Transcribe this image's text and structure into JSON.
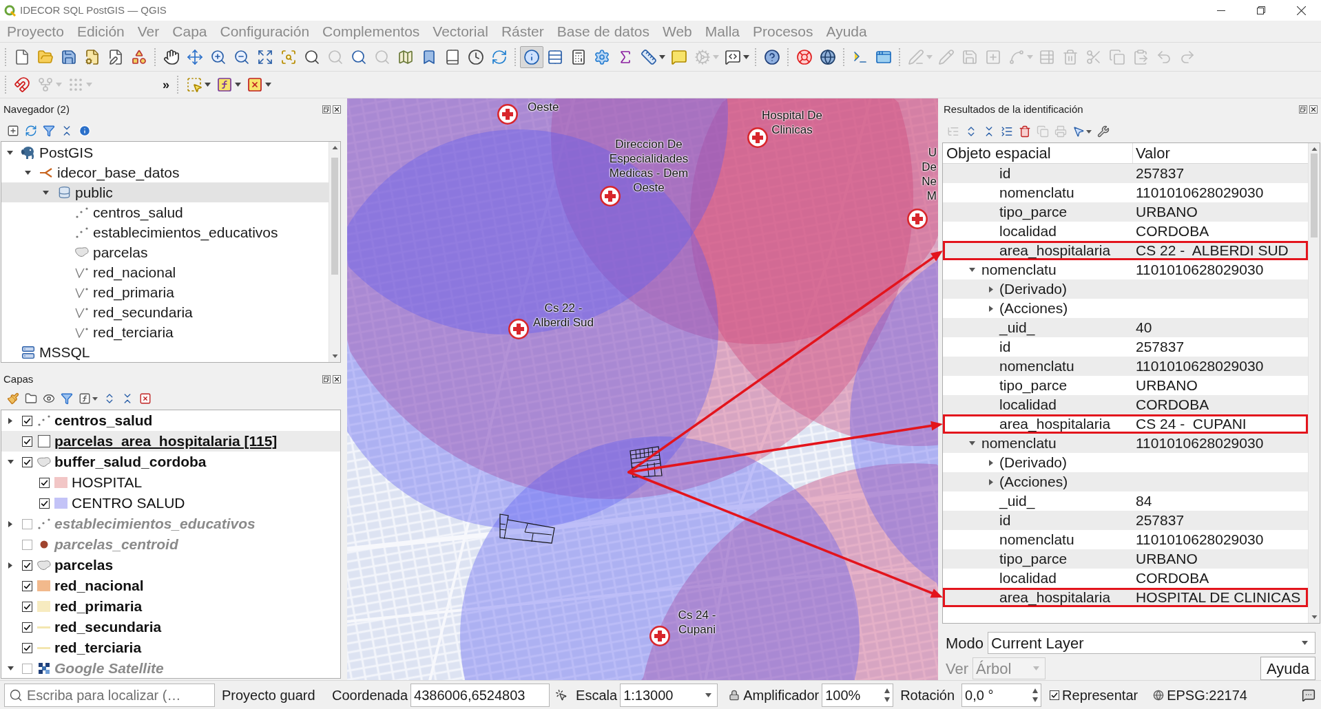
{
  "window": {
    "title": "IDECOR SQL PostGIS — QGIS",
    "focused": false
  },
  "menu": [
    "Proyecto",
    "Edición",
    "Ver",
    "Capa",
    "Configuración",
    "Complementos",
    "Vectorial",
    "Ráster",
    "Base de datos",
    "Web",
    "Malla",
    "Procesos",
    "Ayuda"
  ],
  "toolbar_rows": [
    {
      "toolbars": [
        {
          "buttons": [
            {
              "kind": "button",
              "disabled": false,
              "pressed": false
            },
            {
              "kind": "button",
              "disabled": false,
              "pressed": false
            },
            {
              "kind": "button",
              "disabled": false,
              "pressed": false
            },
            {
              "kind": "button",
              "disabled": false,
              "pressed": false
            },
            {
              "kind": "button",
              "disabled": false,
              "pressed": false
            },
            {
              "kind": "button",
              "disabled": false,
              "pressed": false
            }
          ]
        },
        {
          "buttons": [
            {
              "kind": "button",
              "disabled": false,
              "pressed": false
            },
            {
              "kind": "button",
              "disabled": false,
              "pressed": false
            },
            {
              "kind": "button",
              "disabled": false,
              "pressed": false
            },
            {
              "kind": "button",
              "disabled": false,
              "pressed": false
            },
            {
              "kind": "button",
              "disabled": false,
              "pressed": false
            },
            {
              "kind": "button",
              "disabled": false,
              "pressed": false
            },
            {
              "kind": "button",
              "disabled": false,
              "pressed": false
            },
            {
              "kind": "button",
              "disabled": true,
              "pressed": false
            },
            {
              "kind": "button",
              "disabled": false,
              "pressed": false
            },
            {
              "kind": "button",
              "disabled": true,
              "pressed": false
            },
            {
              "kind": "button",
              "disabled": false,
              "pressed": false
            },
            {
              "kind": "button",
              "disabled": false,
              "pressed": false
            },
            {
              "kind": "button",
              "disabled": false,
              "pressed": false
            },
            {
              "kind": "button",
              "disabled": false,
              "pressed": false
            },
            {
              "kind": "button",
              "disabled": false,
              "pressed": false
            }
          ]
        },
        {
          "buttons": [
            {
              "kind": "button",
              "disabled": false,
              "pressed": true
            },
            {
              "kind": "button",
              "disabled": false,
              "pressed": false
            },
            {
              "kind": "button",
              "disabled": false,
              "pressed": false
            },
            {
              "kind": "button",
              "disabled": false,
              "pressed": false
            },
            {
              "kind": "button",
              "disabled": false,
              "pressed": false
            },
            {
              "kind": "menu",
              "disabled": false,
              "pressed": false
            },
            {
              "kind": "button",
              "disabled": false,
              "pressed": false
            },
            {
              "kind": "menu",
              "disabled": true,
              "pressed": false
            },
            {
              "kind": "menu",
              "disabled": false,
              "pressed": false
            }
          ]
        },
        {
          "buttons": [
            {
              "kind": "button",
              "disabled": false,
              "pressed": false
            }
          ]
        },
        {
          "buttons": [
            {
              "kind": "button",
              "disabled": false,
              "pressed": false
            },
            {
              "kind": "button",
              "disabled": false,
              "pressed": false
            }
          ]
        },
        {
          "buttons": [
            {
              "kind": "button",
              "disabled": false,
              "pressed": false
            },
            {
              "kind": "button",
              "disabled": false,
              "pressed": false
            }
          ]
        },
        {
          "buttons": [
            {
              "kind": "menu",
              "disabled": true,
              "pressed": false
            },
            {
              "kind": "button",
              "disabled": true,
              "pressed": false
            },
            {
              "kind": "button",
              "disabled": true,
              "pressed": false
            },
            {
              "kind": "button",
              "disabled": true,
              "pressed": false
            },
            {
              "kind": "menu",
              "disabled": true,
              "pressed": false
            },
            {
              "kind": "button",
              "disabled": true,
              "pressed": false
            },
            {
              "kind": "button",
              "disabled": true,
              "pressed": false
            },
            {
              "kind": "button",
              "disabled": true,
              "pressed": false
            },
            {
              "kind": "button",
              "disabled": true,
              "pressed": false
            },
            {
              "kind": "button",
              "disabled": true,
              "pressed": false
            },
            {
              "kind": "button",
              "disabled": true,
              "pressed": false
            },
            {
              "kind": "button",
              "disabled": true,
              "pressed": false
            }
          ]
        }
      ]
    },
    {
      "toolbars": [
        {
          "buttons": [
            {
              "kind": "button",
              "disabled": false,
              "pressed": false
            },
            {
              "kind": "menu",
              "disabled": true,
              "pressed": false
            },
            {
              "kind": "menu",
              "disabled": true,
              "pressed": false
            }
          ],
          "overflow": "»"
        },
        {
          "buttons": [
            {
              "kind": "menu",
              "disabled": false,
              "pressed": false
            },
            {
              "kind": "menu",
              "disabled": false,
              "pressed": false
            },
            {
              "kind": "menu",
              "disabled": false,
              "pressed": false
            }
          ]
        }
      ]
    }
  ],
  "browser": {
    "title": "Navegador (2)",
    "tools": [
      {
        "kind": "button",
        "disabled": false
      },
      {
        "kind": "button",
        "disabled": false
      },
      {
        "kind": "button",
        "disabled": false
      },
      {
        "kind": "button",
        "disabled": false
      },
      {
        "kind": "button",
        "disabled": false
      }
    ],
    "tree": [
      {
        "label": "PostGIS",
        "kind": "postgis",
        "expanded": true,
        "selected": false,
        "children": [
          {
            "label": "idecor_base_datos",
            "kind": "connection",
            "expanded": true,
            "selected": false,
            "children": [
              {
                "label": "public",
                "kind": "schema",
                "expanded": true,
                "selected": true,
                "children": [
                  {
                    "label": "centros_salud",
                    "kind": "point",
                    "selected": false
                  },
                  {
                    "label": "establecimientos_educativos",
                    "kind": "point",
                    "selected": false
                  },
                  {
                    "label": "parcelas",
                    "kind": "polygon",
                    "selected": false
                  },
                  {
                    "label": "red_nacional",
                    "kind": "line",
                    "selected": false
                  },
                  {
                    "label": "red_primaria",
                    "kind": "line",
                    "selected": false
                  },
                  {
                    "label": "red_secundaria",
                    "kind": "line",
                    "selected": false
                  },
                  {
                    "label": "red_terciaria",
                    "kind": "line",
                    "selected": false
                  }
                ]
              }
            ]
          }
        ]
      },
      {
        "label": "MSSQL",
        "kind": "mssql",
        "selected": false
      }
    ]
  },
  "layers": {
    "title": "Capas",
    "tools": [
      {
        "kind": "button",
        "disabled": false
      },
      {
        "kind": "button",
        "disabled": false
      },
      {
        "kind": "button",
        "disabled": false
      },
      {
        "kind": "button",
        "disabled": false
      },
      {
        "kind": "menu",
        "disabled": false
      },
      {
        "kind": "button",
        "disabled": false
      },
      {
        "kind": "button",
        "disabled": false
      },
      {
        "kind": "button",
        "disabled": false
      }
    ],
    "tree": [
      {
        "label": "centros_salud",
        "kind": "point",
        "checked": true,
        "expanded": false,
        "selected": false,
        "underlined": false
      },
      {
        "label": "parcelas_area_hospitalaria [115]",
        "kind": "outline",
        "checked": true,
        "selected": true,
        "underlined": true
      },
      {
        "label": "buffer_salud_cordoba",
        "kind": "polygon",
        "checked": true,
        "expanded": true,
        "selected": false,
        "underlined": false,
        "children": [
          {
            "label": "HOSPITAL",
            "kind": "fill",
            "color": "#f2c6c6",
            "checked": true,
            "selected": false,
            "underlined": false
          },
          {
            "label": "CENTRO SALUD",
            "kind": "fill",
            "color": "#c3c3f7",
            "checked": true,
            "selected": false,
            "underlined": false
          }
        ]
      },
      {
        "label": "establecimientos_educativos",
        "kind": "point",
        "checked": false,
        "expanded": false,
        "selected": false,
        "underlined": false
      },
      {
        "label": "parcelas_centroid",
        "kind": "dot",
        "color": "#a0442e",
        "checked": false,
        "selected": false,
        "underlined": false
      },
      {
        "label": "parcelas",
        "kind": "polygon",
        "checked": true,
        "expanded": false,
        "selected": false,
        "underlined": false
      },
      {
        "label": "red_nacional",
        "kind": "fill",
        "color": "#f2b98c",
        "checked": true,
        "selected": false,
        "underlined": false
      },
      {
        "label": "red_primaria",
        "kind": "fill",
        "color": "#f7ebc0",
        "checked": true,
        "selected": false,
        "underlined": false
      },
      {
        "label": "red_secundaria",
        "kind": "line",
        "color": "#f3e6b0",
        "checked": true,
        "selected": false,
        "underlined": false
      },
      {
        "label": "red_terciaria",
        "kind": "line",
        "color": "#f3e6b0",
        "checked": true,
        "selected": false,
        "underlined": false
      },
      {
        "label": "Google Satellite",
        "kind": "raster",
        "checked": false,
        "expanded": true,
        "selected": false,
        "underlined": false
      }
    ]
  },
  "map": {
    "markers": [
      {
        "label_lines": [
          "Oeste"
        ]
      },
      {
        "label_lines": [
          "Direccion De",
          "Especialidades",
          "Medicas - Dem",
          "Oeste"
        ]
      },
      {
        "label_lines": [
          "Hospital De",
          "Clinicas"
        ]
      },
      {
        "label_lines": [
          "U",
          "De",
          "Ne",
          "M"
        ]
      },
      {
        "label_lines": [
          "Cs 22 -",
          "Alberdi Sud"
        ]
      },
      {
        "label_lines": [
          "Cs 24 -",
          "Cupani"
        ]
      }
    ]
  },
  "identify": {
    "title": "Resultados de la identificación",
    "tools": [
      {
        "kind": "button",
        "disabled": true
      },
      {
        "kind": "button",
        "disabled": false
      },
      {
        "kind": "button",
        "disabled": false
      },
      {
        "kind": "button",
        "disabled": false
      },
      {
        "kind": "button",
        "disabled": false
      },
      {
        "kind": "button",
        "disabled": true
      },
      {
        "kind": "button",
        "disabled": true
      },
      {
        "kind": "menu",
        "disabled": false
      },
      {
        "kind": "button",
        "disabled": false
      }
    ],
    "columns": [
      "Objeto espacial",
      "Valor"
    ],
    "features": [
      {
        "children": [
          {
            "kind": "attribute",
            "field": "id",
            "value": "257837",
            "highlighted": false
          },
          {
            "kind": "attribute",
            "field": "nomenclatu",
            "value": "1101010628029030",
            "highlighted": false
          },
          {
            "kind": "attribute",
            "field": "tipo_parce",
            "value": "URBANO",
            "highlighted": false
          },
          {
            "kind": "attribute",
            "field": "localidad",
            "value": "CORDOBA",
            "highlighted": false
          },
          {
            "kind": "attribute",
            "field": "area_hospitalaria",
            "value": "CS 22 -  ALBERDI SUD",
            "highlighted": true
          }
        ]
      },
      {
        "field": "nomenclatu",
        "value": "1101010628029030",
        "expanded": true,
        "children": [
          {
            "kind": "group",
            "field": "(Derivado)",
            "expanded": false,
            "highlighted": false
          },
          {
            "kind": "group",
            "field": "(Acciones)",
            "expanded": false,
            "highlighted": false
          },
          {
            "kind": "attribute",
            "field": "_uid_",
            "value": "40",
            "highlighted": false
          },
          {
            "kind": "attribute",
            "field": "id",
            "value": "257837",
            "highlighted": false
          },
          {
            "kind": "attribute",
            "field": "nomenclatu",
            "value": "1101010628029030",
            "highlighted": false
          },
          {
            "kind": "attribute",
            "field": "tipo_parce",
            "value": "URBANO",
            "highlighted": false
          },
          {
            "kind": "attribute",
            "field": "localidad",
            "value": "CORDOBA",
            "highlighted": false
          },
          {
            "kind": "attribute",
            "field": "area_hospitalaria",
            "value": "CS 24 -  CUPANI",
            "highlighted": true
          }
        ]
      },
      {
        "field": "nomenclatu",
        "value": "1101010628029030",
        "expanded": true,
        "children": [
          {
            "kind": "group",
            "field": "(Derivado)",
            "expanded": false,
            "highlighted": false
          },
          {
            "kind": "group",
            "field": "(Acciones)",
            "expanded": false,
            "highlighted": false
          },
          {
            "kind": "attribute",
            "field": "_uid_",
            "value": "84",
            "highlighted": false
          },
          {
            "kind": "attribute",
            "field": "id",
            "value": "257837",
            "highlighted": false
          },
          {
            "kind": "attribute",
            "field": "nomenclatu",
            "value": "1101010628029030",
            "highlighted": false
          },
          {
            "kind": "attribute",
            "field": "tipo_parce",
            "value": "URBANO",
            "highlighted": false
          },
          {
            "kind": "attribute",
            "field": "localidad",
            "value": "CORDOBA",
            "highlighted": false
          },
          {
            "kind": "attribute",
            "field": "area_hospitalaria",
            "value": "HOSPITAL DE CLINICAS",
            "highlighted": true
          }
        ]
      }
    ],
    "mode": {
      "label": "Modo",
      "value": "Current Layer"
    },
    "view": {
      "label": "Ver",
      "value": "Árbol",
      "disabled": true
    },
    "help_button": "Ayuda"
  },
  "status": {
    "locator": {
      "placeholder": "Escriba para localizar (…"
    },
    "message": "Proyecto guard",
    "coordinate": {
      "label": "Coordenada",
      "value": "4386006,6524803"
    },
    "scale": {
      "label": "Escala",
      "value": "1:13000"
    },
    "magnifier": {
      "label": "Amplificador",
      "value": "100%"
    },
    "rotation": {
      "label": "Rotación",
      "value": "0,0 °"
    },
    "render": {
      "label": "Representar",
      "checked": true
    },
    "crs": "EPSG:22174"
  }
}
